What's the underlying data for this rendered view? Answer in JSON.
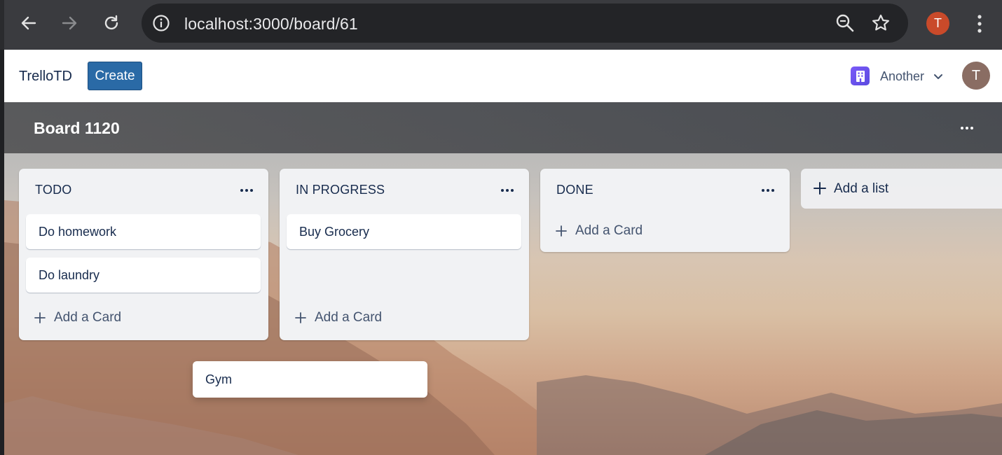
{
  "browser": {
    "url": "localhost:3000/board/61",
    "profile_initial": "T"
  },
  "header": {
    "brand": "TrelloTD",
    "create_label": "Create",
    "workspace_name": "Another",
    "user_initial": "T"
  },
  "board": {
    "title": "Board 1120",
    "lists": [
      {
        "title": "TODO",
        "cards": [
          "Do homework",
          "Do laundry"
        ],
        "add_card_label": "Add a Card"
      },
      {
        "title": "IN PROGRESS",
        "cards": [
          "Buy Grocery"
        ],
        "add_card_label": "Add a Card"
      },
      {
        "title": "DONE",
        "cards": [],
        "add_card_label": "Add a Card"
      }
    ],
    "add_list_label": "Add a list",
    "dragging_card": "Gym"
  },
  "colors": {
    "create_button": "#2a6aa6",
    "profile_badge": "#c94a2a",
    "workspace_icon": "#7a5af8",
    "user_avatar": "#8a6d63"
  }
}
